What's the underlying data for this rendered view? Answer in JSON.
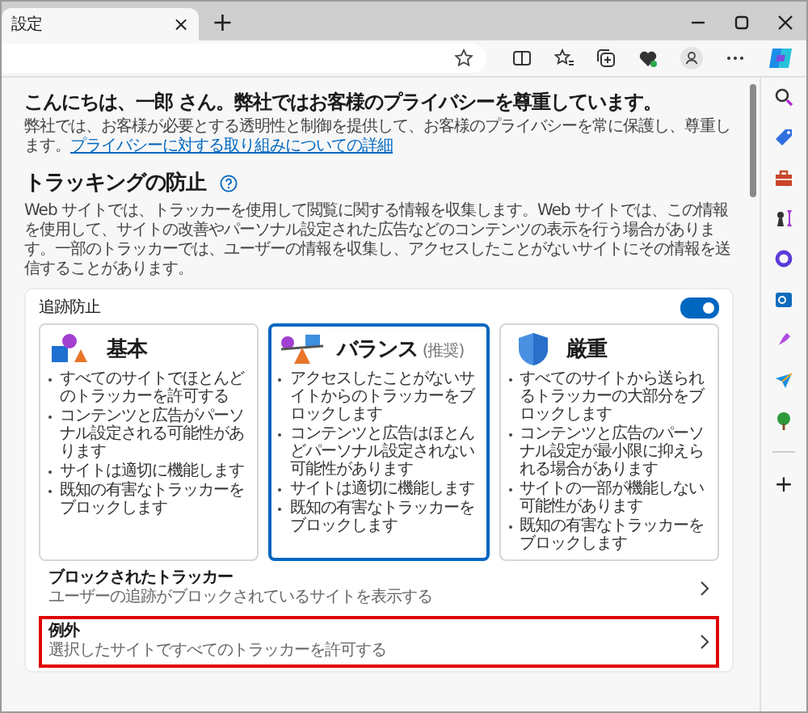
{
  "tab": {
    "title": "設定",
    "close": "×"
  },
  "new_tab": "+",
  "greeting": "こんにちは、一郎 さん。弊社ではお客様のプライバシーを尊重しています。",
  "intro": {
    "text": "弊社では、お客様が必要とする透明性と制御を提供して、お客様のプライバシーを常に保護し、尊重します。",
    "link": "プライバシーに対する取り組みについての詳細"
  },
  "section": {
    "title": "トラッキングの防止",
    "description": "Web サイトでは、トラッカーを使用して閲覧に関する情報を収集します。Web サイトでは、この情報を使用して、サイトの改善やパーソナル設定された広告などのコンテンツの表示を行う場合があります。一部のトラッカーでは、ユーザーの情報を収集し、アクセスしたことがないサイトにその情報を送信することがあります。"
  },
  "tracking": {
    "label": "追跡防止",
    "enabled": true,
    "modes": [
      {
        "kind": "basic",
        "name": "基本",
        "selected": false,
        "bullets": [
          "すべてのサイトでほとんどのトラッカーを許可する",
          "コンテンツと広告がパーソナル設定される可能性があります",
          "サイトは適切に機能します",
          "既知の有害なトラッカーをブロックします"
        ]
      },
      {
        "kind": "balanced",
        "name": "バランス",
        "note": "(推奨)",
        "selected": true,
        "bullets": [
          "アクセスしたことがないサイトからのトラッカーをブロックします",
          "コンテンツと広告はほとんどパーソナル設定されない可能性があります",
          "サイトは適切に機能します",
          "既知の有害なトラッカーをブロックします"
        ]
      },
      {
        "kind": "strict",
        "name": "厳重",
        "selected": false,
        "bullets": [
          "すべてのサイトから送られるトラッカーの大部分をブロックします",
          "コンテンツと広告のパーソナル設定が最小限に抑えられる場合があります",
          "サイトの一部が機能しない可能性があります",
          "既知の有害なトラッカーをブロックします"
        ]
      }
    ]
  },
  "rows": [
    {
      "title": "ブロックされたトラッカー",
      "subtitle": "ユーザーの追跡がブロックされているサイトを表示する",
      "highlighted": false
    },
    {
      "title": "例外",
      "subtitle": "選択したサイトですべてのトラッカーを許可する",
      "highlighted": true
    }
  ],
  "sidebar_add": "+"
}
